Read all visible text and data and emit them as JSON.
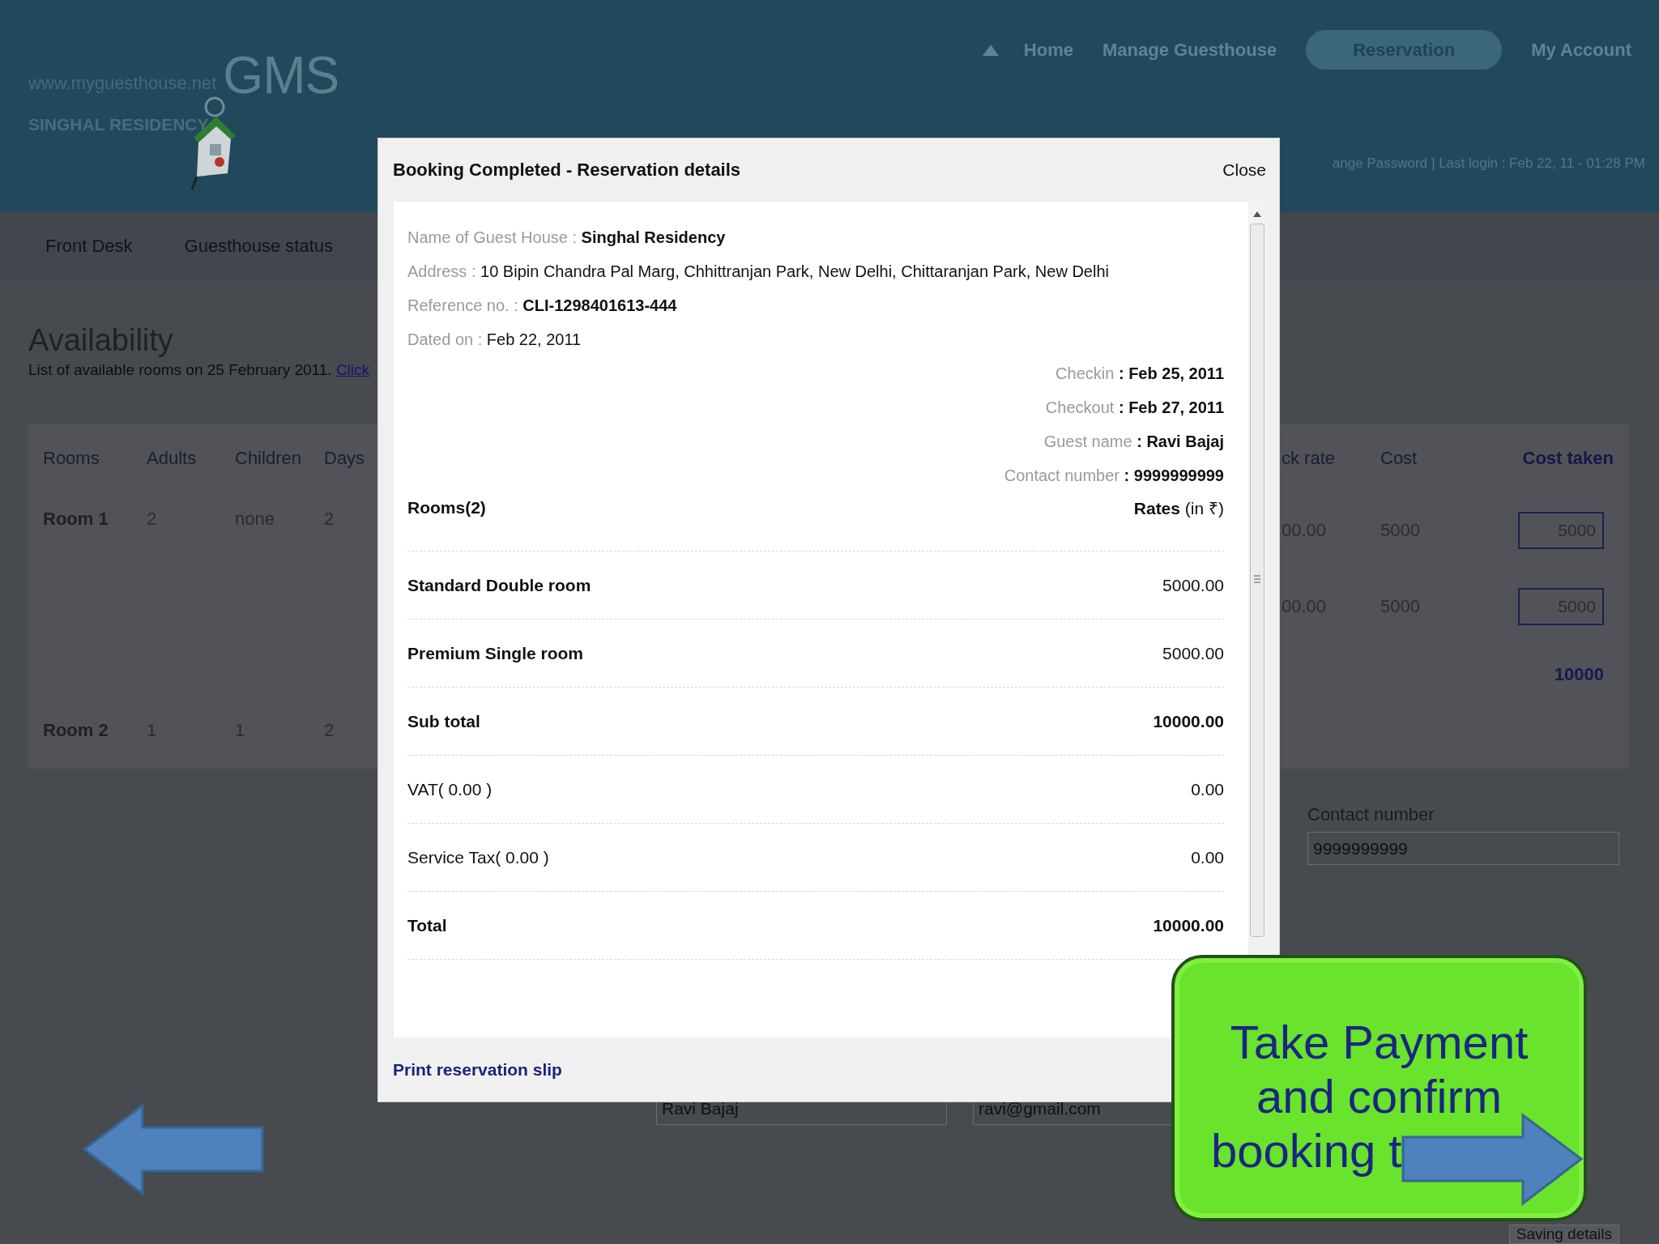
{
  "site": {
    "url": "www.myguesthouse.net",
    "logo": "GMS",
    "name": "SINGHAL RESIDENCY"
  },
  "nav": [
    {
      "label": "Home",
      "selected": false
    },
    {
      "label": "Manage Guesthouse",
      "selected": false
    },
    {
      "label": "Reservation",
      "selected": true
    },
    {
      "label": "My Account",
      "selected": false
    }
  ],
  "login_info": "ange Password ] Last login : Feb 22, 11 - 01:28 PM",
  "tabs": [
    {
      "label": "Front Desk"
    },
    {
      "label": "Guesthouse status"
    }
  ],
  "availability": {
    "title": "Availability",
    "subtitle": "List of available rooms on 25 February 2011.",
    "link": "Click"
  },
  "rooms_table": {
    "columns_left": [
      "Rooms",
      "Adults",
      "Children",
      "Days"
    ],
    "columns_right": [
      "ck rate",
      "Cost",
      "Cost taken"
    ],
    "rows": [
      {
        "room": "Room 1",
        "adults": "2",
        "children": "none",
        "days": "2",
        "rates": [
          {
            "rate": "00.00",
            "cost": "5000",
            "cost_taken": "5000"
          },
          {
            "rate": "00.00",
            "cost": "5000",
            "cost_taken": "5000"
          }
        ]
      },
      {
        "room": "Room 2",
        "adults": "1",
        "children": "1",
        "days": "2"
      }
    ],
    "total": "10000"
  },
  "contact": {
    "label": "Contact number",
    "value": "9999999999"
  },
  "guest_fields": [
    "Ravi Bajaj",
    "ravi@gmail.com"
  ],
  "save_button": "Saving details",
  "modal": {
    "title": "Booking Completed - Reservation details",
    "close": "Close",
    "details": [
      {
        "label": "Name of Guest House : ",
        "value": "Singhal Residency",
        "bold": true
      },
      {
        "label": "Address : ",
        "value": "10 Bipin Chandra Pal Marg, Chhittranjan Park, New Delhi, Chittaranjan Park, New Delhi",
        "bold": false
      },
      {
        "label": "Reference no. : ",
        "value": "CLI-1298401613-444",
        "bold": true
      },
      {
        "label": "Dated on : ",
        "value": "Feb 22, 2011",
        "bold": false
      }
    ],
    "stay": [
      {
        "label": "Checkin",
        "value": ": Feb 25, 2011"
      },
      {
        "label": "Checkout",
        "value": ": Feb 27, 2011"
      },
      {
        "label": "Guest name",
        "value": ": Ravi Bajaj"
      },
      {
        "label": "Contact number",
        "value": ": 9999999999"
      }
    ],
    "rooms_heading": "Rooms(2)",
    "rates_heading": "Rates",
    "rates_unit": "(in ₹)",
    "lines": [
      {
        "label": "Standard Double room",
        "amount": "5000.00",
        "label_bold": true,
        "amount_bold": false
      },
      {
        "label": "Premium Single room",
        "amount": "5000.00",
        "label_bold": true,
        "amount_bold": false
      },
      {
        "label": "Sub total",
        "amount": "10000.00",
        "label_bold": true,
        "amount_bold": true
      },
      {
        "label": "VAT( 0.00 )",
        "amount": "0.00",
        "label_bold": false,
        "amount_bold": false
      },
      {
        "label": "Service Tax( 0.00 )",
        "amount": "0.00",
        "label_bold": false,
        "amount_bold": false
      },
      {
        "label": "Total",
        "amount": "10000.00",
        "label_bold": true,
        "amount_bold": true
      }
    ],
    "print_link": "Print reservation slip"
  },
  "callout": {
    "lines": [
      "Take Payment",
      "and confirm",
      "booking t"
    ]
  }
}
